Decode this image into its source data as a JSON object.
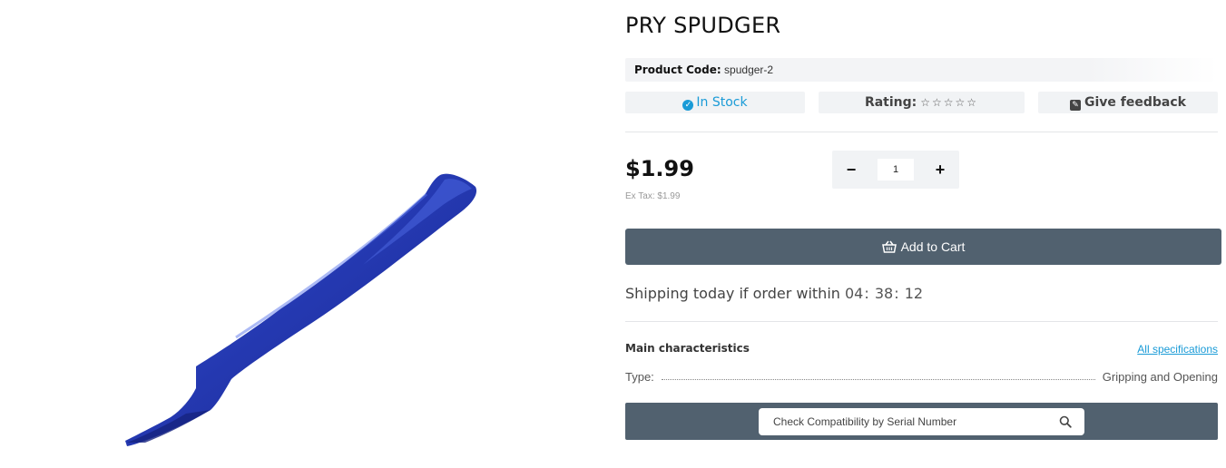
{
  "product": {
    "title": "PRY SPUDGER",
    "code_label": "Product Code:",
    "code_value": "spudger-2",
    "image_color": "#2a3fb0"
  },
  "status": {
    "stock": "In Stock",
    "rating_label": "Rating:",
    "rating_stars": "☆☆☆☆☆",
    "rating_value": 0,
    "feedback": "Give feedback"
  },
  "pricing": {
    "price": "$1.99",
    "ex_tax": "Ex Tax: $1.99"
  },
  "quantity": {
    "minus": "−",
    "value": "1",
    "plus": "+"
  },
  "cart": {
    "label": "Add to Cart"
  },
  "shipping": {
    "text": "Shipping today if order within",
    "hours": "04",
    "minutes": "38",
    "seconds": "12",
    "separator": ":"
  },
  "characteristics": {
    "heading": "Main characteristics",
    "all_specs": "All specifications",
    "rows": [
      {
        "label": "Type:",
        "value": "Gripping and Opening"
      }
    ]
  },
  "compatibility": {
    "placeholder": "Check Compatibility by Serial Number"
  },
  "colors": {
    "accent": "#1a9bd7",
    "button_bg": "#51616f",
    "pill_bg": "#f1f3f5"
  }
}
